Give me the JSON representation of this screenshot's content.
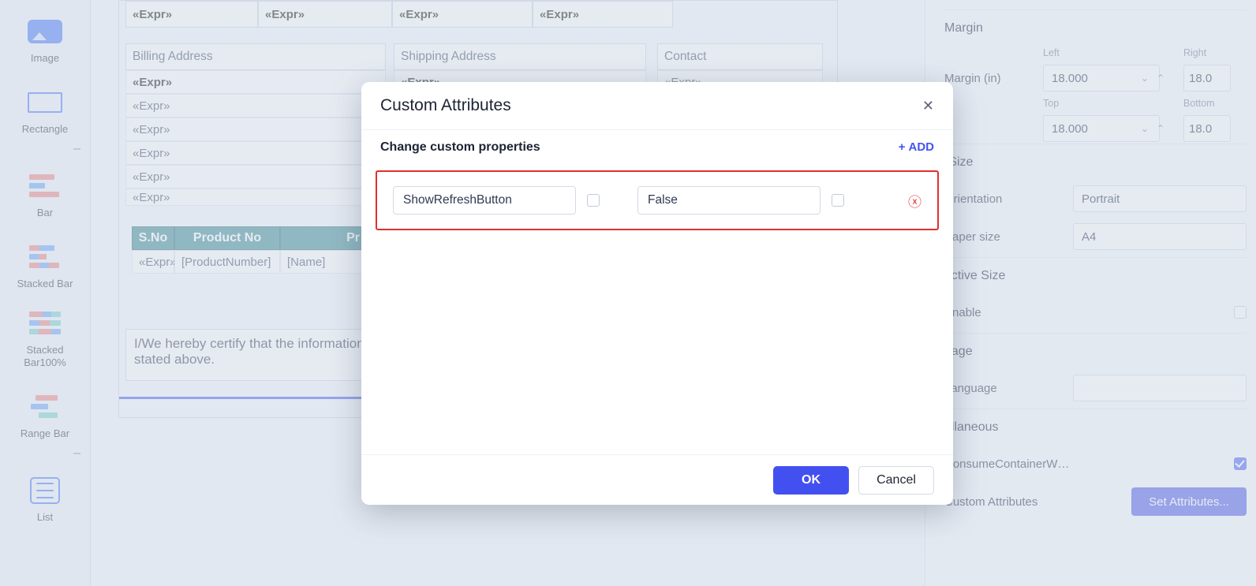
{
  "toolbox": {
    "items": [
      {
        "label": "Image",
        "icon": "image-icon"
      },
      {
        "label": "Rectangle",
        "icon": "rectangle-icon"
      },
      {
        "label": "Bar",
        "icon": "bar-chart-icon"
      },
      {
        "label": "Stacked Bar",
        "icon": "stacked-bar-icon"
      },
      {
        "label": "Stacked\nBar100%",
        "icon": "stacked-bar-100-icon"
      },
      {
        "label": "Range Bar",
        "icon": "range-bar-icon"
      },
      {
        "label": "List",
        "icon": "list-icon"
      }
    ]
  },
  "canvas": {
    "expr_placeholder": "«Expr»",
    "section_labels": {
      "billing": "Billing Address",
      "shipping": "Shipping Address",
      "contact": "Contact"
    },
    "table": {
      "columns": [
        "S.No",
        "Product No",
        "Pr"
      ],
      "cells": [
        "«Expr»",
        "[ProductNumber]",
        "[Name]"
      ]
    },
    "certify": "I/We hereby certify that the information stated above."
  },
  "dialog": {
    "title": "Custom Attributes",
    "subtitle": "Change custom properties",
    "add_label": "ADD",
    "row": {
      "key": "ShowRefreshButton",
      "value": "False"
    },
    "ok_label": "OK",
    "cancel_label": "Cancel"
  },
  "props": {
    "margin": {
      "title": "Margin",
      "in_label": "Margin (in)",
      "left_label": "Left",
      "right_label": "Right",
      "top_label": "Top",
      "bottom_label": "Bottom",
      "left": "18.000",
      "right": "18.0",
      "top": "18.000",
      "bottom": "18.0"
    },
    "size": {
      "title": "rSize",
      "orientation_label": "Orientation",
      "orientation": "Portrait",
      "paper_label": "Paper size",
      "paper": "A4"
    },
    "active": {
      "title": "active Size",
      "enable_label": "Enable"
    },
    "lang": {
      "title": "uage",
      "label": "Language"
    },
    "misc": {
      "title": "ellaneous",
      "consume_label": "ConsumeContainerW…",
      "custom_label": "Custom Attributes",
      "set_button": "Set Attributes..."
    }
  }
}
